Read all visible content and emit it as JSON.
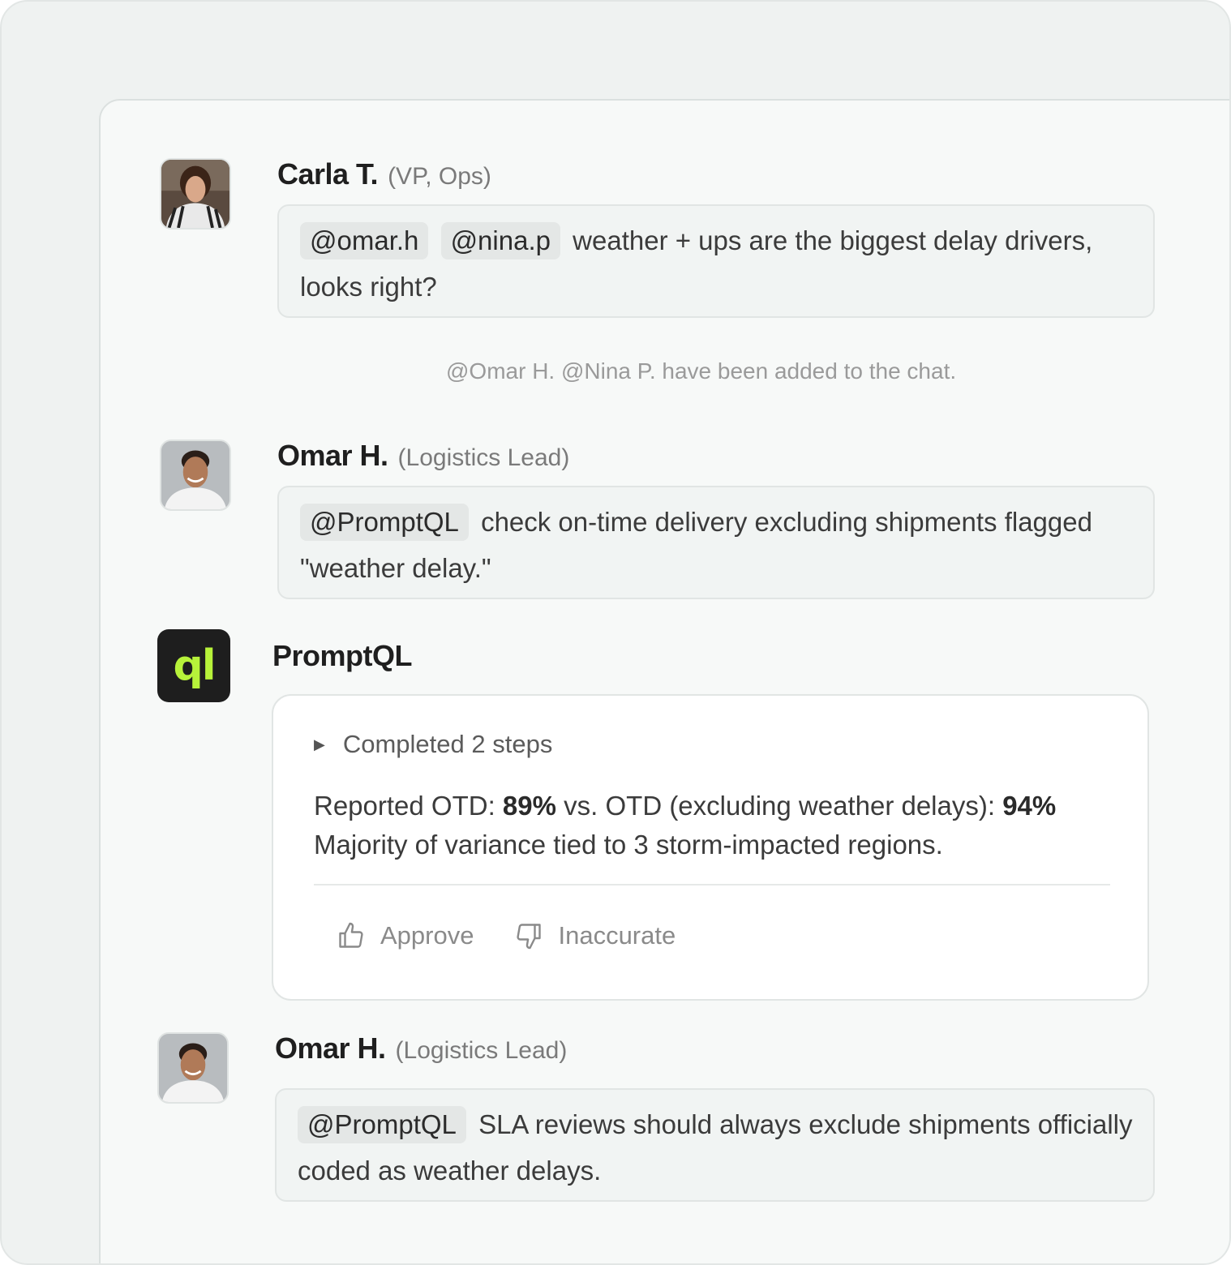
{
  "messages": [
    {
      "sender": "Carla T.",
      "role": "(VP, Ops)",
      "mentions": [
        "@omar.h",
        "@nina.p"
      ],
      "text": "weather + ups are the biggest delay drivers, looks right?"
    },
    {
      "sender": "Omar H.",
      "role": "(Logistics Lead)",
      "mentions": [
        "@PromptQL"
      ],
      "text": "check on-time delivery excluding shipments flagged \"weather delay.\""
    },
    {
      "sender": "Omar H.",
      "role": "(Logistics Lead)",
      "mentions": [
        "@PromptQL"
      ],
      "text": "SLA reviews should always exclude shipments officially coded as weather delays."
    }
  ],
  "system_note": "@Omar H. @Nina P. have been added to the chat.",
  "bot": {
    "name": "PromptQL",
    "logo_text": "ql",
    "logo_color": "#b7f23a",
    "steps_label": "Completed 2 steps",
    "result": {
      "reported_label": "Reported OTD: ",
      "reported_value": "89%",
      "vs_label": " vs. OTD (excluding weather delays): ",
      "excluded_value": "94%",
      "summary": "Majority of variance tied to 3 storm-impacted regions."
    },
    "approve_label": "Approve",
    "inaccurate_label": "Inaccurate"
  },
  "icons": {
    "steps_toggle": "caret-right-icon",
    "approve": "thumbs-up-icon",
    "inaccurate": "thumbs-down-icon"
  }
}
